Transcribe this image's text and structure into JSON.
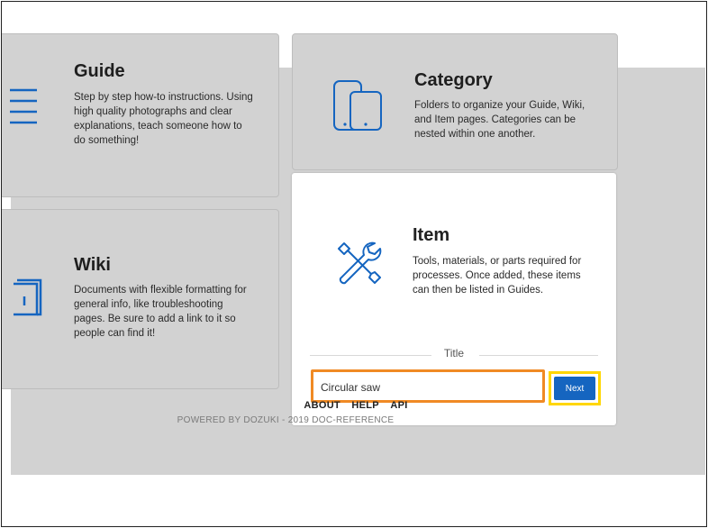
{
  "cards": {
    "guide": {
      "title": "Guide",
      "description": "Step by step how-to instructions. Using high quality photographs and clear explanations, teach someone how to do something!"
    },
    "category": {
      "title": "Category",
      "description": "Folders to organize your Guide, Wiki, and Item pages. Categories can be nested within one another."
    },
    "wiki": {
      "title": "Wiki",
      "description": "Documents with flexible formatting for general info, like troubleshooting pages. Be sure to add a link to it so people can find it!"
    },
    "item": {
      "title": "Item",
      "description": "Tools, materials, or parts required for processes. Once added, these items can then be listed in Guides."
    }
  },
  "form": {
    "section_label": "Title",
    "title_value": "Circular saw",
    "next_label": "Next"
  },
  "footer": {
    "links": [
      "ABOUT",
      "HELP",
      "API"
    ],
    "powered_by": "POWERED BY DOZUKI - 2019 DOC-REFERENCE"
  },
  "colors": {
    "accent_blue": "#1565c0",
    "highlight_orange": "#f08a24",
    "highlight_yellow": "#ffd600",
    "overlay_gray": "#d2d2d2"
  },
  "icons": {
    "guide": "list-icon",
    "category": "devices-icon",
    "wiki": "book-icon",
    "item": "tools-icon"
  }
}
